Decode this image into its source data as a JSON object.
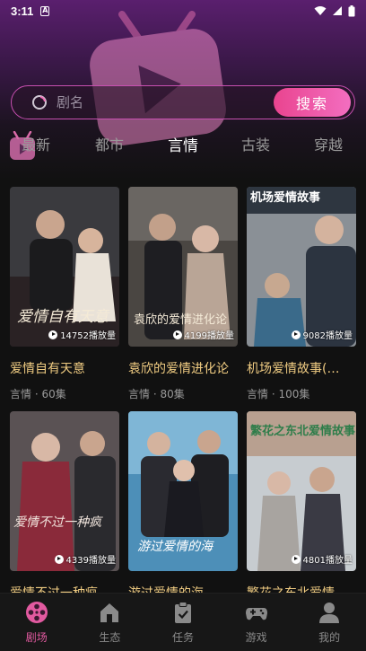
{
  "status_bar": {
    "time": "3:11",
    "notif": "A"
  },
  "search": {
    "placeholder": "剧名",
    "button_label": "搜索"
  },
  "tabs": [
    {
      "label": "最新",
      "active": false
    },
    {
      "label": "都市",
      "active": false
    },
    {
      "label": "言情",
      "active": true
    },
    {
      "label": "古装",
      "active": false
    },
    {
      "label": "穿越",
      "active": false
    }
  ],
  "cards": [
    {
      "title": "爱情自有天意",
      "meta": "言情 · 60集",
      "plays": "14752播放量",
      "poster_text": "爱情自有天意"
    },
    {
      "title": "袁欣的爱情进化论",
      "meta": "言情 · 80集",
      "plays": "4199播放量",
      "poster_text": "袁欣的爱情进化论"
    },
    {
      "title": "机场爱情故事(…",
      "meta": "言情 · 100集",
      "plays": "9082播放量",
      "poster_text": "机场爱情故事"
    },
    {
      "title": "爱情不过一种疯",
      "meta": "",
      "plays": "4339播放量",
      "poster_text": "爱情不过一种疯"
    },
    {
      "title": "游过爱情的海",
      "meta": "",
      "plays": "",
      "poster_text": "游过爱情的海"
    },
    {
      "title": "繁花之东北爱情故事",
      "meta": "",
      "plays": "4801播放量",
      "poster_text": "繁花之东北爱情故事"
    }
  ],
  "nav": [
    {
      "label": "剧场",
      "icon": "film-reel-icon",
      "active": true
    },
    {
      "label": "生态",
      "icon": "home-icon",
      "active": false
    },
    {
      "label": "任务",
      "icon": "clipboard-check-icon",
      "active": false
    },
    {
      "label": "游戏",
      "icon": "gamepad-icon",
      "active": false
    },
    {
      "label": "我的",
      "icon": "person-icon",
      "active": false
    }
  ],
  "colors": {
    "accent": "#e25aa0",
    "title": "#f0cc82",
    "search_border": "#c74fb0"
  }
}
